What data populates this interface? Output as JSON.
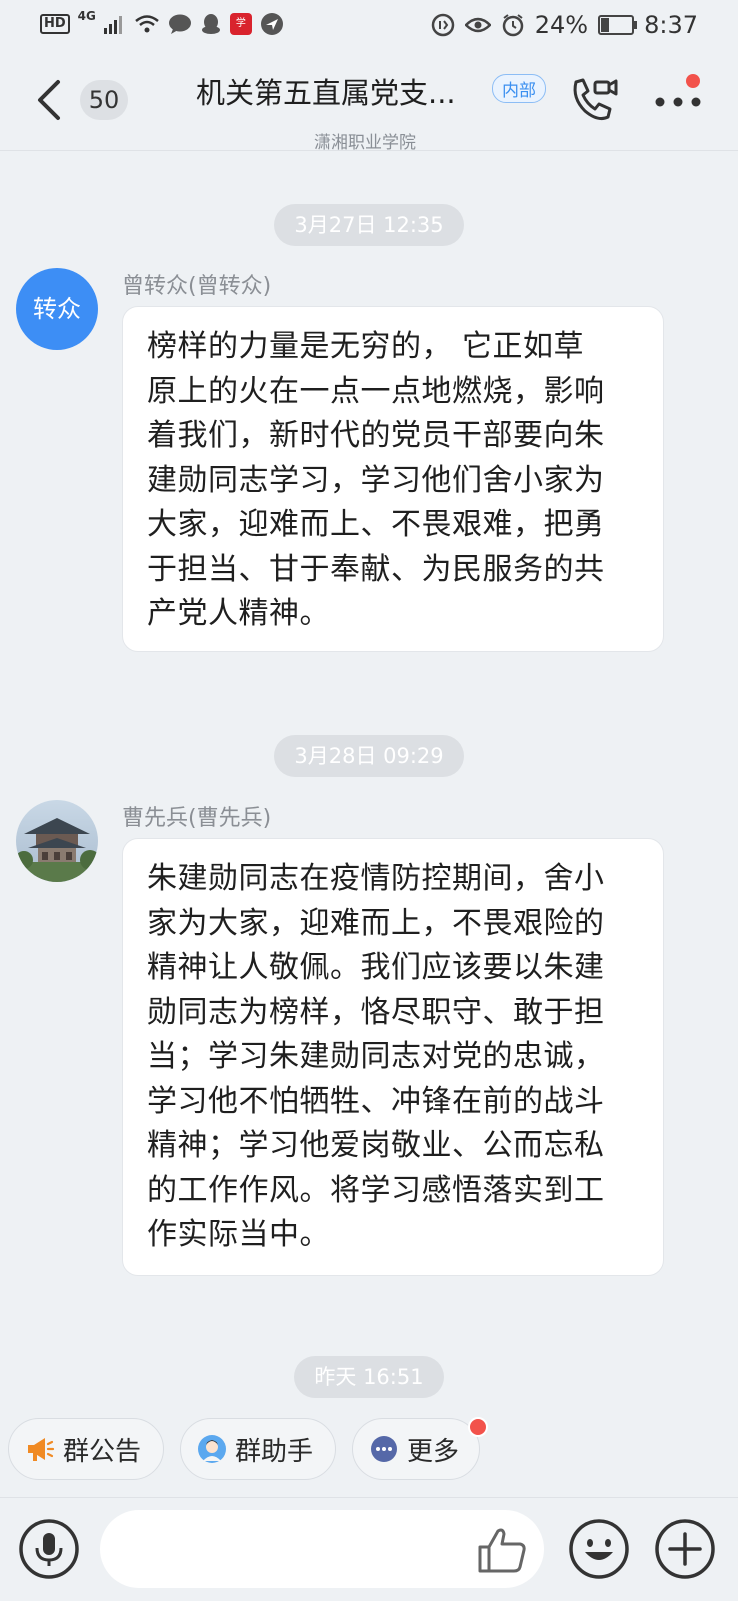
{
  "status_bar": {
    "network": "4G",
    "hd": "HD",
    "battery": "24%",
    "battery_level": 0.24,
    "time": "8:37"
  },
  "header": {
    "unread_count": "50",
    "title": "机关第五直属党支...",
    "badge": "内部",
    "subtitle": "潇湘职业学院"
  },
  "messages": [
    {
      "timestamp": "3月27日 12:35",
      "sender": "曾转众(曾转众)",
      "avatar_text": "转众",
      "lines": [
        "榜样的力量是无穷的， 它正如草",
        "原上的火在一点一点地燃烧，影响",
        "着我们，新时代的党员干部要向朱",
        "建勋同志学习，学习他们舍小家为",
        "大家，迎难而上、不畏艰难，把勇",
        "于担当、甘于奉献、为民服务的共",
        "产党人精神。"
      ]
    },
    {
      "timestamp": "3月28日 09:29",
      "sender": "曹先兵(曹先兵)",
      "lines": [
        "朱建勋同志在疫情防控期间，舍小",
        "家为大家，迎难而上，不畏艰险的",
        "精神让人敬佩。我们应该要以朱建",
        "勋同志为榜样，恪尽职守、敢于担",
        "当；学习朱建勋同志对党的忠诚，",
        "学习他不怕牺牲、冲锋在前的战斗",
        "精神；学习他爱岗敬业、公而忘私",
        "的工作作风。将学习感悟落实到工",
        "作实际当中。"
      ]
    }
  ],
  "last_timestamp": "昨天 16:51",
  "quick_actions": [
    {
      "label": "群公告",
      "icon": "megaphone-icon"
    },
    {
      "label": "群助手",
      "icon": "assistant-avatar-icon"
    },
    {
      "label": "更多",
      "icon": "more-dots-icon"
    }
  ],
  "input": {
    "placeholder": ""
  },
  "colors": {
    "accent": "#3d8ef5",
    "badge_text": "#3a8ff0",
    "notification": "#f2524b",
    "megaphone": "#f08a24"
  }
}
